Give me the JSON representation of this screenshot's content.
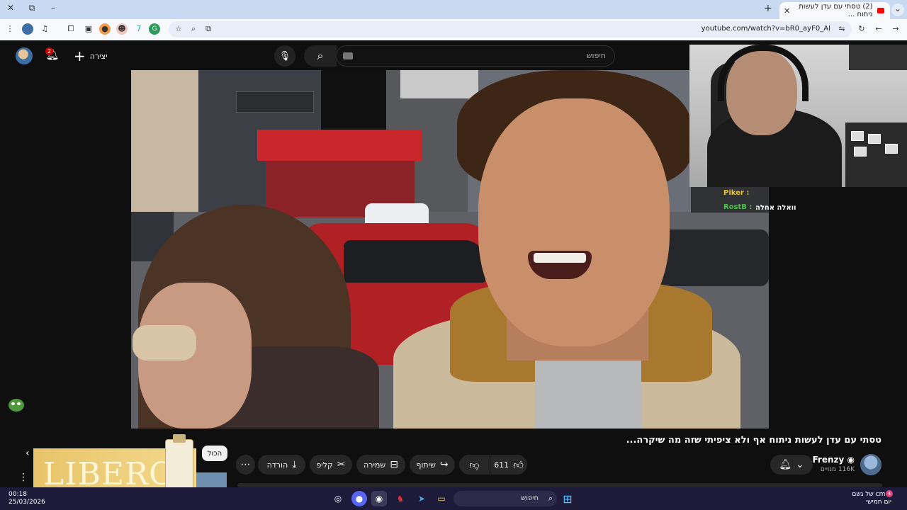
{
  "browser": {
    "tab_title": "(2) טסתי עם עדן לעשות ניתוח ‪...‬",
    "url": "youtube.com/watch?v=bR0_ayF0_AI",
    "close_glyph": "✕",
    "new_tab_glyph": "+",
    "minimize_glyph": "–",
    "restore_glyph": "⧉",
    "window_close_glyph": "✕"
  },
  "youtube": {
    "search_placeholder": "חיפוש",
    "create_label": "יצירה",
    "notifications_count": "2",
    "video_title": "טסתי עם עדן לעשות ניתוח אף ולא ציפיתי שזה מה שיקרה...",
    "channel_name": "Frenzy",
    "subscribers": "116K מנויים",
    "like_count": "611",
    "share_label": "שיתוף",
    "save_label": "שמירה",
    "clip_label": "קליפ",
    "download_label": "הורדה",
    "all_chip": "הכול"
  },
  "overlay": {
    "chat_line_1": "Piker :",
    "chat_line_2": "RostB :",
    "chat_main": "וואלה אחלה",
    "ad_brand": "LIBERO"
  },
  "taskbar": {
    "search_placeholder": "חיפוש",
    "time": "00:18",
    "date": "25/03/2026",
    "weather_line1": "2 cm של גשם",
    "weather_line2": "יום חמישי",
    "weather_badge": "4"
  },
  "colors": {
    "youtube_bg": "#0f0f0f",
    "chrome_tab_strip": "#c9d9f1",
    "notification_red": "#cc0000",
    "chat_piker": "#e6c12f",
    "chat_rostb": "#4fc14f"
  }
}
